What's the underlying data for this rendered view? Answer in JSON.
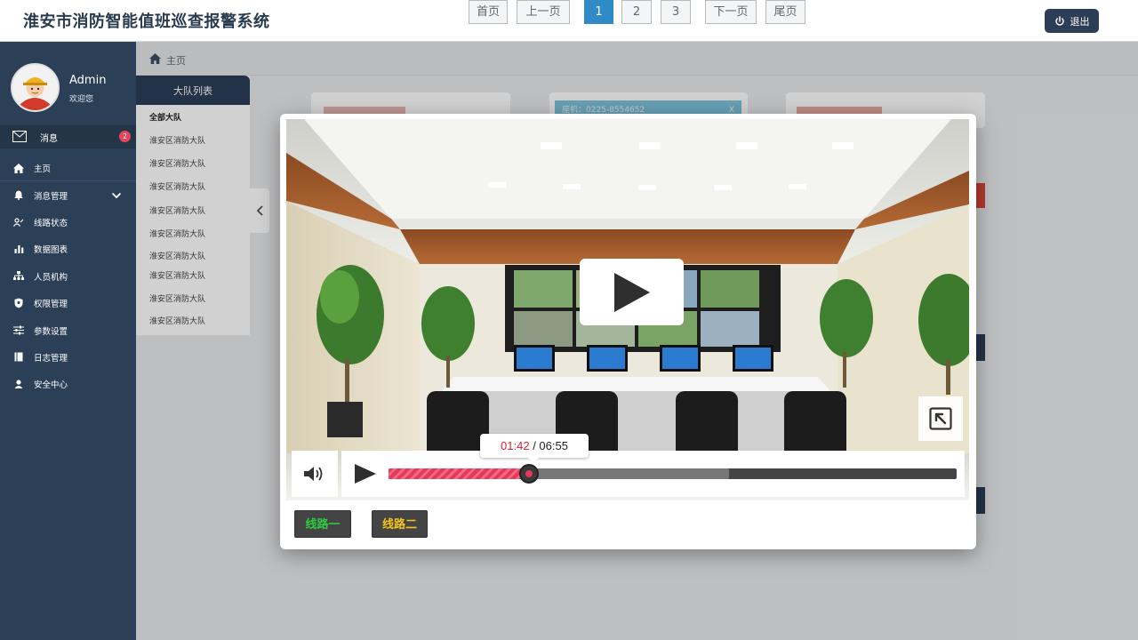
{
  "header": {
    "title": "淮安市消防智能值班巡查报警系统",
    "logout_label": "退出"
  },
  "profile": {
    "name": "Admin",
    "welcome": "欢迎您"
  },
  "messages": {
    "label": "消息",
    "count": "2"
  },
  "menu": [
    {
      "label": "主页",
      "icon": "home-icon"
    },
    {
      "label": "消息管理",
      "icon": "bell-icon"
    },
    {
      "label": "线路状态",
      "icon": "route-icon"
    },
    {
      "label": "数据图表",
      "icon": "bar-chart-icon"
    },
    {
      "label": "人员机构",
      "icon": "org-icon"
    },
    {
      "label": "权限管理",
      "icon": "shield-icon"
    },
    {
      "label": "参数设置",
      "icon": "sliders-icon"
    },
    {
      "label": "日志管理",
      "icon": "log-icon"
    },
    {
      "label": "安全中心",
      "icon": "user-icon"
    }
  ],
  "breadcrumb": {
    "label": "主页"
  },
  "team_list": {
    "title": "大队列表",
    "all_label": "全部大队",
    "items": [
      "淮安区消防大队",
      "淮安区消防大队",
      "淮安区消防大队",
      "淮安区消防大队",
      "淮安区消防大队",
      "淮安区消防大队",
      "淮安区消防大队",
      "淮安区消防大队",
      "淮安区消防大队"
    ]
  },
  "background_card": {
    "phone_text": "座机：0225-8554652",
    "close": "X"
  },
  "player": {
    "current_time": "01:42",
    "total_time": "06:55",
    "separator": " / ",
    "progress": 0.2465,
    "buffered": 0.6
  },
  "lines": [
    {
      "label": "线路一",
      "color": "#2ecc40"
    },
    {
      "label": "线路二",
      "color": "#f5c518"
    }
  ],
  "pagination": {
    "first": "首页",
    "prev": "上一页",
    "pages": [
      "1",
      "2",
      "3"
    ],
    "current": "1",
    "next": "下一页",
    "last": "尾页"
  },
  "colors": {
    "sidebar": "#2b3f57",
    "accent": "#2e8bc6",
    "badge": "#e8445d",
    "progress": "#e8385a"
  }
}
